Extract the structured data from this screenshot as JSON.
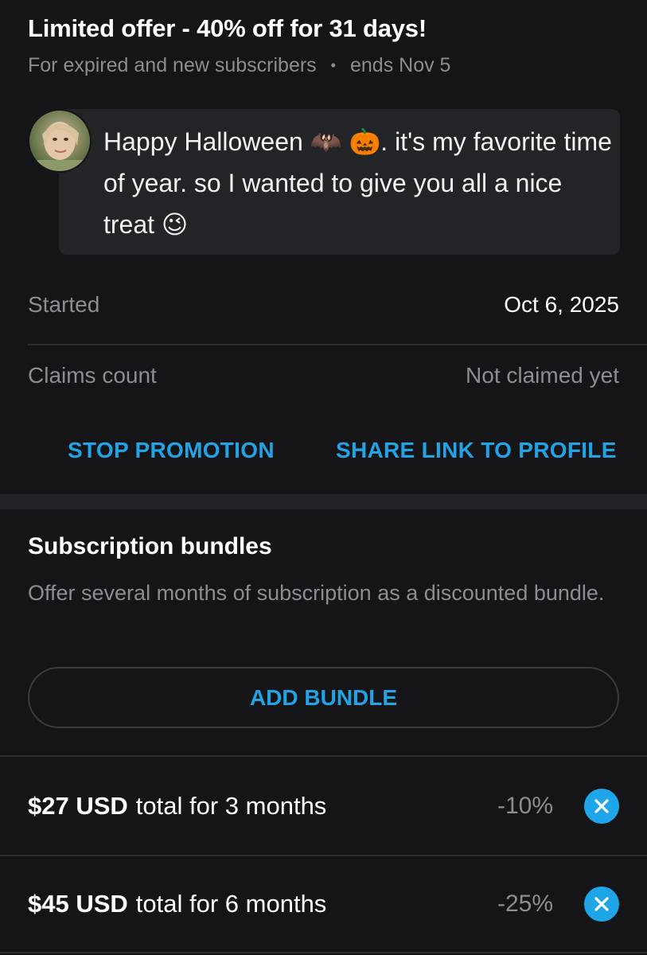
{
  "promo": {
    "title": "Limited offer - 40% off for 31 days!",
    "audience": "For expired and new subscribers",
    "separator": "•",
    "ends": "ends Nov 5",
    "message": "Happy Halloween 🦇 🎃. it's my favorite time of year. so I wanted to give you all a nice treat 😉",
    "started_label": "Started",
    "started_value": "Oct 6, 2025",
    "claims_label": "Claims count",
    "claims_value": "Not claimed yet",
    "stop_label": "STOP PROMOTION",
    "share_label": "SHARE LINK TO PROFILE"
  },
  "bundles": {
    "title": "Subscription bundles",
    "description": "Offer several months of subscription as a discounted bundle.",
    "add_label": "ADD BUNDLE",
    "items": [
      {
        "price": "$27 USD",
        "desc": "total for 3 months",
        "discount": "-10%"
      },
      {
        "price": "$45 USD",
        "desc": "total for 6 months",
        "discount": "-25%"
      }
    ]
  },
  "colors": {
    "background": "#151517",
    "card": "#232428",
    "accent": "#22a3e6",
    "muted_text": "#8a8d93"
  }
}
